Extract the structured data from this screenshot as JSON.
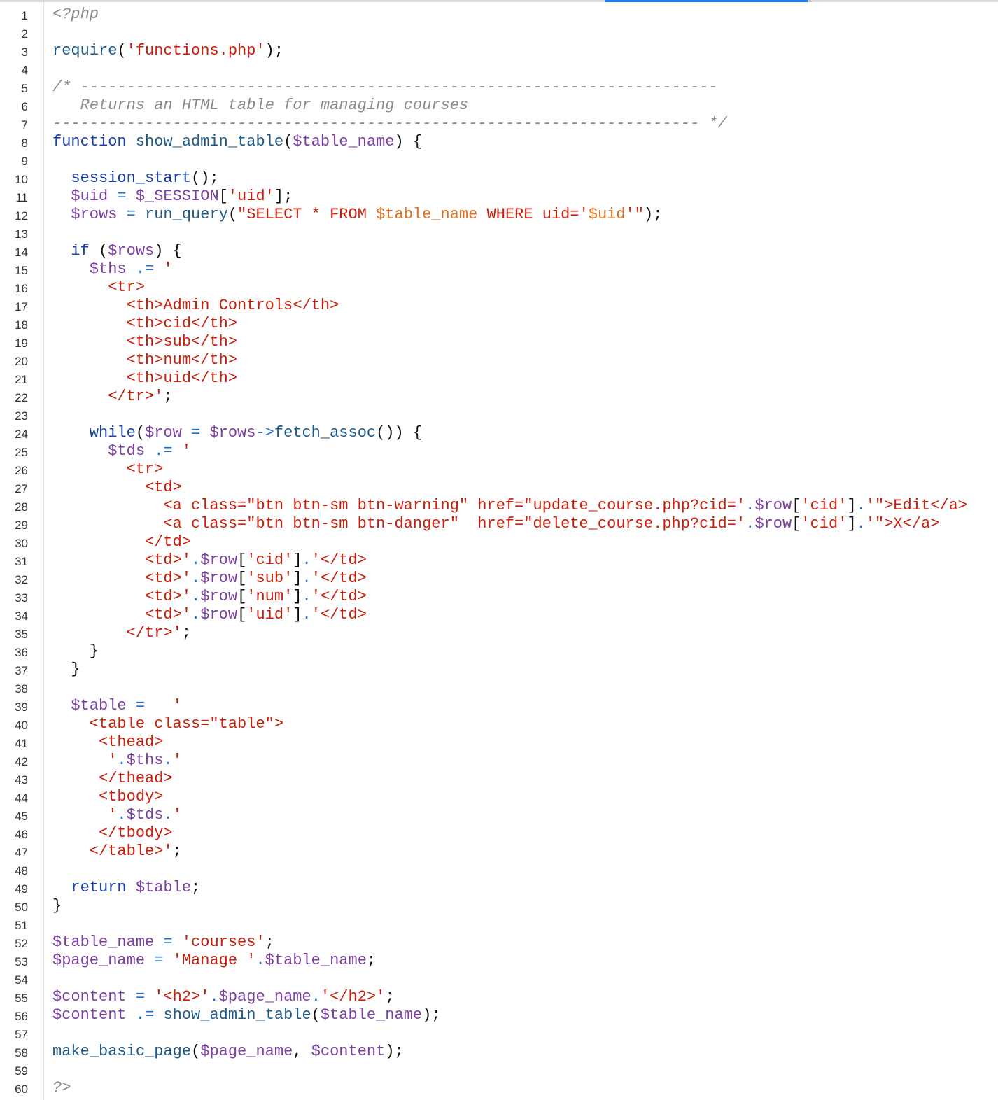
{
  "editor": {
    "lines": [
      {
        "n": "1",
        "tokens": [
          {
            "t": "<?php",
            "c": "c-com"
          }
        ]
      },
      {
        "n": "2",
        "tokens": []
      },
      {
        "n": "3",
        "tokens": [
          {
            "t": "require",
            "c": "c-fn"
          },
          {
            "t": "(",
            "c": "c-dk"
          },
          {
            "t": "'functions.php'",
            "c": "c-str"
          },
          {
            "t": ");",
            "c": "c-dk"
          }
        ]
      },
      {
        "n": "4",
        "tokens": []
      },
      {
        "n": "5",
        "tokens": [
          {
            "t": "/* ---------------------------------------------------------------------",
            "c": "c-com"
          }
        ]
      },
      {
        "n": "6",
        "tokens": [
          {
            "t": "   Returns an HTML table for managing courses",
            "c": "c-com"
          }
        ]
      },
      {
        "n": "7",
        "tokens": [
          {
            "t": "---------------------------------------------------------------------- */",
            "c": "c-com"
          }
        ]
      },
      {
        "n": "8",
        "tokens": [
          {
            "t": "function ",
            "c": "c-kw"
          },
          {
            "t": "show_admin_table",
            "c": "c-fn"
          },
          {
            "t": "(",
            "c": "c-dk"
          },
          {
            "t": "$table_name",
            "c": "c-var"
          },
          {
            "t": ") {",
            "c": "c-dk"
          }
        ]
      },
      {
        "n": "9",
        "tokens": []
      },
      {
        "n": "10",
        "tokens": [
          {
            "t": "  session_start",
            "c": "c-kw"
          },
          {
            "t": "();",
            "c": "c-dk"
          }
        ]
      },
      {
        "n": "11",
        "tokens": [
          {
            "t": "  $uid",
            "c": "c-var"
          },
          {
            "t": " = ",
            "c": "c-op"
          },
          {
            "t": "$_SESSION",
            "c": "c-var"
          },
          {
            "t": "[",
            "c": "c-dk"
          },
          {
            "t": "'uid'",
            "c": "c-str"
          },
          {
            "t": "];",
            "c": "c-dk"
          }
        ]
      },
      {
        "n": "12",
        "tokens": [
          {
            "t": "  $rows",
            "c": "c-var"
          },
          {
            "t": " = ",
            "c": "c-op"
          },
          {
            "t": "run_query",
            "c": "c-fn"
          },
          {
            "t": "(",
            "c": "c-dk"
          },
          {
            "t": "\"SELECT * FROM ",
            "c": "c-str"
          },
          {
            "t": "$table_name",
            "c": "c-int"
          },
          {
            "t": " WHERE uid='",
            "c": "c-str"
          },
          {
            "t": "$uid",
            "c": "c-int"
          },
          {
            "t": "'\"",
            "c": "c-str"
          },
          {
            "t": ");",
            "c": "c-dk"
          }
        ]
      },
      {
        "n": "13",
        "tokens": []
      },
      {
        "n": "14",
        "tokens": [
          {
            "t": "  if ",
            "c": "c-kw"
          },
          {
            "t": "(",
            "c": "c-dk"
          },
          {
            "t": "$rows",
            "c": "c-var"
          },
          {
            "t": ") {",
            "c": "c-dk"
          }
        ]
      },
      {
        "n": "15",
        "tokens": [
          {
            "t": "    $ths",
            "c": "c-var"
          },
          {
            "t": " .= ",
            "c": "c-op"
          },
          {
            "t": "'",
            "c": "c-str"
          }
        ]
      },
      {
        "n": "16",
        "tokens": [
          {
            "t": "      <tr>",
            "c": "c-str"
          }
        ]
      },
      {
        "n": "17",
        "tokens": [
          {
            "t": "        <th>Admin Controls</th>",
            "c": "c-str"
          }
        ]
      },
      {
        "n": "18",
        "tokens": [
          {
            "t": "        <th>cid</th>",
            "c": "c-str"
          }
        ]
      },
      {
        "n": "19",
        "tokens": [
          {
            "t": "        <th>sub</th>",
            "c": "c-str"
          }
        ]
      },
      {
        "n": "20",
        "tokens": [
          {
            "t": "        <th>num</th>",
            "c": "c-str"
          }
        ]
      },
      {
        "n": "21",
        "tokens": [
          {
            "t": "        <th>uid</th>",
            "c": "c-str"
          }
        ]
      },
      {
        "n": "22",
        "tokens": [
          {
            "t": "      </tr>'",
            "c": "c-str"
          },
          {
            "t": ";",
            "c": "c-dk"
          }
        ]
      },
      {
        "n": "23",
        "tokens": []
      },
      {
        "n": "24",
        "tokens": [
          {
            "t": "    while",
            "c": "c-kw"
          },
          {
            "t": "(",
            "c": "c-dk"
          },
          {
            "t": "$row",
            "c": "c-var"
          },
          {
            "t": " = ",
            "c": "c-op"
          },
          {
            "t": "$rows",
            "c": "c-var"
          },
          {
            "t": "->",
            "c": "c-op"
          },
          {
            "t": "fetch_assoc",
            "c": "c-fn"
          },
          {
            "t": "()) {",
            "c": "c-dk"
          }
        ]
      },
      {
        "n": "25",
        "tokens": [
          {
            "t": "      $tds",
            "c": "c-var"
          },
          {
            "t": " .= ",
            "c": "c-op"
          },
          {
            "t": "'",
            "c": "c-str"
          }
        ]
      },
      {
        "n": "26",
        "tokens": [
          {
            "t": "        <tr>",
            "c": "c-str"
          }
        ]
      },
      {
        "n": "27",
        "tokens": [
          {
            "t": "          <td>",
            "c": "c-str"
          }
        ]
      },
      {
        "n": "28",
        "tokens": [
          {
            "t": "            <a class=\"btn btn-sm btn-warning\" href=\"update_course.php?cid='",
            "c": "c-str"
          },
          {
            "t": ".",
            "c": "c-op"
          },
          {
            "t": "$row",
            "c": "c-var"
          },
          {
            "t": "[",
            "c": "c-dk"
          },
          {
            "t": "'cid'",
            "c": "c-str"
          },
          {
            "t": "]",
            "c": "c-dk"
          },
          {
            "t": ".",
            "c": "c-op"
          },
          {
            "t": "'\">Edit</a>",
            "c": "c-str"
          }
        ]
      },
      {
        "n": "29",
        "tokens": [
          {
            "t": "            <a class=\"btn btn-sm btn-danger\"  href=\"delete_course.php?cid='",
            "c": "c-str"
          },
          {
            "t": ".",
            "c": "c-op"
          },
          {
            "t": "$row",
            "c": "c-var"
          },
          {
            "t": "[",
            "c": "c-dk"
          },
          {
            "t": "'cid'",
            "c": "c-str"
          },
          {
            "t": "]",
            "c": "c-dk"
          },
          {
            "t": ".",
            "c": "c-op"
          },
          {
            "t": "'\">X</a>",
            "c": "c-str"
          }
        ]
      },
      {
        "n": "30",
        "tokens": [
          {
            "t": "          </td>",
            "c": "c-str"
          }
        ]
      },
      {
        "n": "31",
        "tokens": [
          {
            "t": "          <td>'",
            "c": "c-str"
          },
          {
            "t": ".",
            "c": "c-op"
          },
          {
            "t": "$row",
            "c": "c-var"
          },
          {
            "t": "[",
            "c": "c-dk"
          },
          {
            "t": "'cid'",
            "c": "c-str"
          },
          {
            "t": "]",
            "c": "c-dk"
          },
          {
            "t": ".",
            "c": "c-op"
          },
          {
            "t": "'</td>",
            "c": "c-str"
          }
        ]
      },
      {
        "n": "32",
        "tokens": [
          {
            "t": "          <td>'",
            "c": "c-str"
          },
          {
            "t": ".",
            "c": "c-op"
          },
          {
            "t": "$row",
            "c": "c-var"
          },
          {
            "t": "[",
            "c": "c-dk"
          },
          {
            "t": "'sub'",
            "c": "c-str"
          },
          {
            "t": "]",
            "c": "c-dk"
          },
          {
            "t": ".",
            "c": "c-op"
          },
          {
            "t": "'</td>",
            "c": "c-str"
          }
        ]
      },
      {
        "n": "33",
        "tokens": [
          {
            "t": "          <td>'",
            "c": "c-str"
          },
          {
            "t": ".",
            "c": "c-op"
          },
          {
            "t": "$row",
            "c": "c-var"
          },
          {
            "t": "[",
            "c": "c-dk"
          },
          {
            "t": "'num'",
            "c": "c-str"
          },
          {
            "t": "]",
            "c": "c-dk"
          },
          {
            "t": ".",
            "c": "c-op"
          },
          {
            "t": "'</td>",
            "c": "c-str"
          }
        ]
      },
      {
        "n": "34",
        "tokens": [
          {
            "t": "          <td>'",
            "c": "c-str"
          },
          {
            "t": ".",
            "c": "c-op"
          },
          {
            "t": "$row",
            "c": "c-var"
          },
          {
            "t": "[",
            "c": "c-dk"
          },
          {
            "t": "'uid'",
            "c": "c-str"
          },
          {
            "t": "]",
            "c": "c-dk"
          },
          {
            "t": ".",
            "c": "c-op"
          },
          {
            "t": "'</td>",
            "c": "c-str"
          }
        ]
      },
      {
        "n": "35",
        "tokens": [
          {
            "t": "        </tr>'",
            "c": "c-str"
          },
          {
            "t": ";",
            "c": "c-dk"
          }
        ]
      },
      {
        "n": "36",
        "tokens": [
          {
            "t": "    }",
            "c": "c-dk"
          }
        ]
      },
      {
        "n": "37",
        "tokens": [
          {
            "t": "  }",
            "c": "c-dk"
          }
        ]
      },
      {
        "n": "38",
        "tokens": []
      },
      {
        "n": "39",
        "tokens": [
          {
            "t": "  $table",
            "c": "c-var"
          },
          {
            "t": " = ",
            "c": "c-op"
          },
          {
            "t": "  '",
            "c": "c-str"
          }
        ]
      },
      {
        "n": "40",
        "tokens": [
          {
            "t": "    <table class=\"table\">",
            "c": "c-str"
          }
        ]
      },
      {
        "n": "41",
        "tokens": [
          {
            "t": "     <thead>",
            "c": "c-str"
          }
        ]
      },
      {
        "n": "42",
        "tokens": [
          {
            "t": "      '",
            "c": "c-str"
          },
          {
            "t": ".",
            "c": "c-op"
          },
          {
            "t": "$ths",
            "c": "c-var"
          },
          {
            "t": ".",
            "c": "c-op"
          },
          {
            "t": "'",
            "c": "c-str"
          }
        ]
      },
      {
        "n": "43",
        "tokens": [
          {
            "t": "     </thead>",
            "c": "c-str"
          }
        ]
      },
      {
        "n": "44",
        "tokens": [
          {
            "t": "     <tbody>",
            "c": "c-str"
          }
        ]
      },
      {
        "n": "45",
        "tokens": [
          {
            "t": "      '",
            "c": "c-str"
          },
          {
            "t": ".",
            "c": "c-op"
          },
          {
            "t": "$tds",
            "c": "c-var"
          },
          {
            "t": ".",
            "c": "c-op"
          },
          {
            "t": "'",
            "c": "c-str"
          }
        ]
      },
      {
        "n": "46",
        "tokens": [
          {
            "t": "     </tbody>",
            "c": "c-str"
          }
        ]
      },
      {
        "n": "47",
        "tokens": [
          {
            "t": "    </table>'",
            "c": "c-str"
          },
          {
            "t": ";",
            "c": "c-dk"
          }
        ]
      },
      {
        "n": "48",
        "tokens": []
      },
      {
        "n": "49",
        "tokens": [
          {
            "t": "  return ",
            "c": "c-kw"
          },
          {
            "t": "$table",
            "c": "c-var"
          },
          {
            "t": ";",
            "c": "c-dk"
          }
        ]
      },
      {
        "n": "50",
        "tokens": [
          {
            "t": "}",
            "c": "c-dk"
          }
        ]
      },
      {
        "n": "51",
        "tokens": []
      },
      {
        "n": "52",
        "tokens": [
          {
            "t": "$table_name",
            "c": "c-var"
          },
          {
            "t": " = ",
            "c": "c-op"
          },
          {
            "t": "'courses'",
            "c": "c-str"
          },
          {
            "t": ";",
            "c": "c-dk"
          }
        ]
      },
      {
        "n": "53",
        "tokens": [
          {
            "t": "$page_name",
            "c": "c-var"
          },
          {
            "t": " = ",
            "c": "c-op"
          },
          {
            "t": "'Manage '",
            "c": "c-str"
          },
          {
            "t": ".",
            "c": "c-op"
          },
          {
            "t": "$table_name",
            "c": "c-var"
          },
          {
            "t": ";",
            "c": "c-dk"
          }
        ]
      },
      {
        "n": "54",
        "tokens": []
      },
      {
        "n": "55",
        "tokens": [
          {
            "t": "$content",
            "c": "c-var"
          },
          {
            "t": " = ",
            "c": "c-op"
          },
          {
            "t": "'<h2>'",
            "c": "c-str"
          },
          {
            "t": ".",
            "c": "c-op"
          },
          {
            "t": "$page_name",
            "c": "c-var"
          },
          {
            "t": ".",
            "c": "c-op"
          },
          {
            "t": "'</h2>'",
            "c": "c-str"
          },
          {
            "t": ";",
            "c": "c-dk"
          }
        ]
      },
      {
        "n": "56",
        "tokens": [
          {
            "t": "$content",
            "c": "c-var"
          },
          {
            "t": " .= ",
            "c": "c-op"
          },
          {
            "t": "show_admin_table",
            "c": "c-fn"
          },
          {
            "t": "(",
            "c": "c-dk"
          },
          {
            "t": "$table_name",
            "c": "c-var"
          },
          {
            "t": ");",
            "c": "c-dk"
          }
        ]
      },
      {
        "n": "57",
        "tokens": []
      },
      {
        "n": "58",
        "tokens": [
          {
            "t": "make_basic_page",
            "c": "c-fn"
          },
          {
            "t": "(",
            "c": "c-dk"
          },
          {
            "t": "$page_name",
            "c": "c-var"
          },
          {
            "t": ", ",
            "c": "c-dk"
          },
          {
            "t": "$content",
            "c": "c-var"
          },
          {
            "t": ");",
            "c": "c-dk"
          }
        ]
      },
      {
        "n": "59",
        "tokens": []
      },
      {
        "n": "60",
        "tokens": [
          {
            "t": "?>",
            "c": "c-com"
          }
        ]
      }
    ]
  }
}
